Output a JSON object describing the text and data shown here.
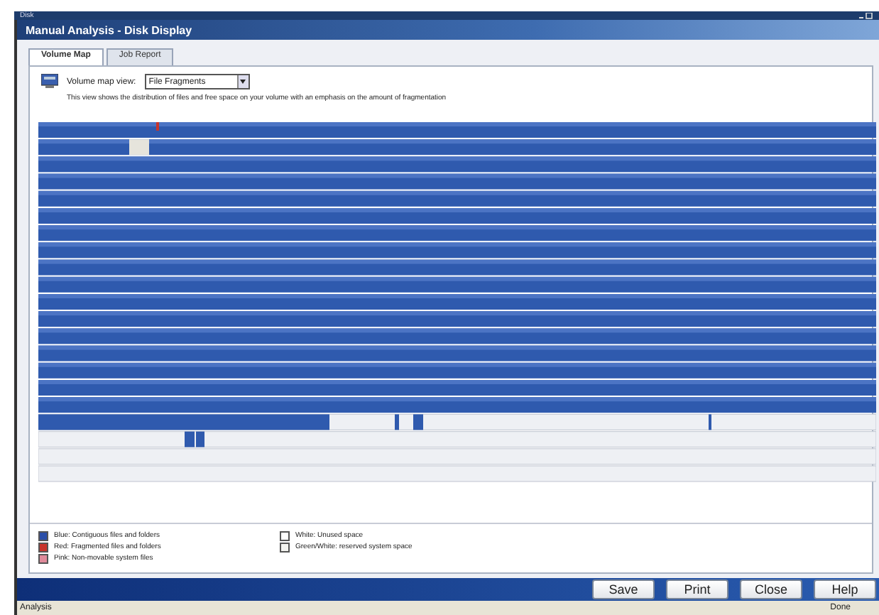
{
  "taskbar": {
    "label": "Disk"
  },
  "window": {
    "title": "Manual Analysis - Disk Display"
  },
  "tabs": [
    {
      "label": "Volume Map",
      "selected": true
    },
    {
      "label": "Job Report",
      "selected": false
    }
  ],
  "view": {
    "label": "Volume map view:",
    "value": "File Fragments",
    "description": "This view shows the distribution of files and free space on your volume with an emphasis on the amount of fragmentation"
  },
  "legend": [
    {
      "label": "Blue: Contiguous files and folders",
      "color": "#2c4fa8"
    },
    {
      "label": "Red: Fragmented files and folders",
      "color": "#c8342c"
    },
    {
      "label": "Pink: Non-movable system files",
      "color": "#e08a9a"
    },
    {
      "label": "White: Unused space",
      "color": "#ffffff"
    },
    {
      "label": "Green/White: reserved system space",
      "color": "#f4f4f0"
    }
  ],
  "buttons": [
    "Save",
    "Print",
    "Close",
    "Help"
  ],
  "status_bar": {
    "left": "Analysis",
    "right": "Done"
  }
}
